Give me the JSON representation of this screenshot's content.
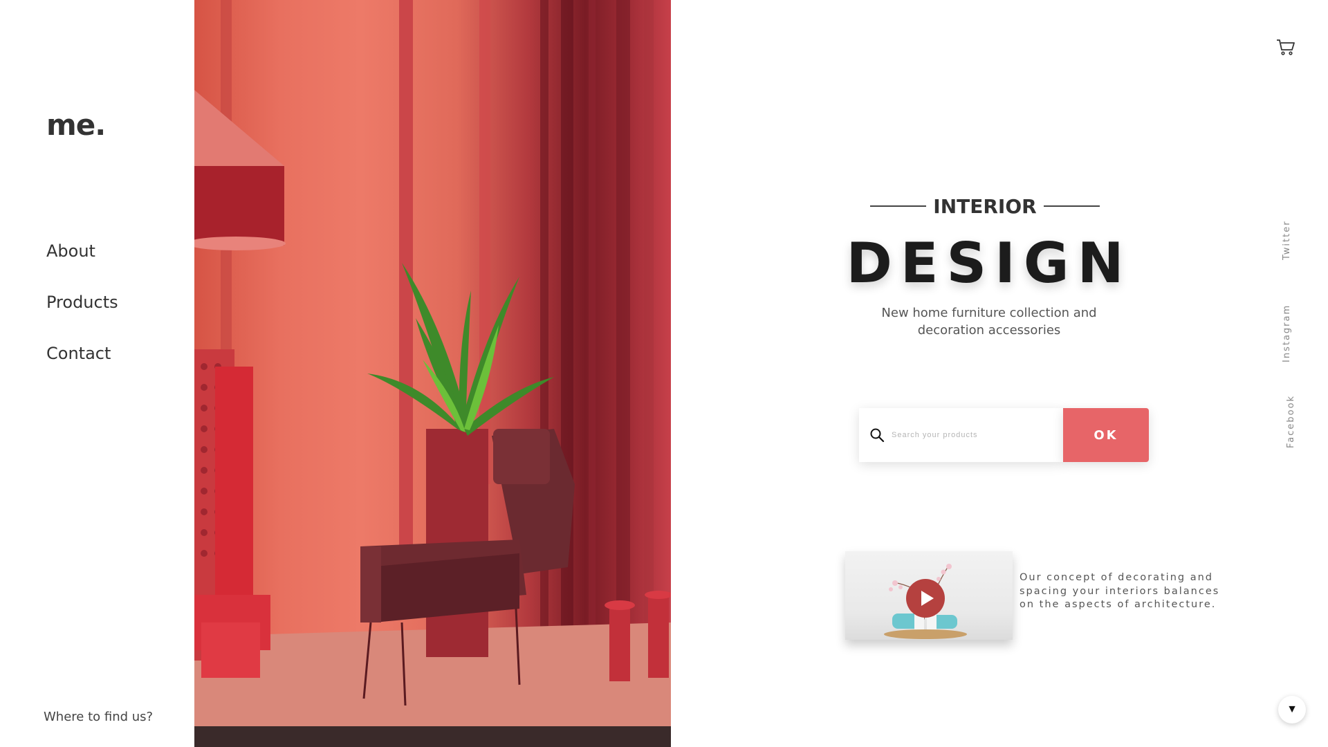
{
  "brand": {
    "logo": "me."
  },
  "nav": {
    "items": [
      {
        "label": "About"
      },
      {
        "label": "Products"
      },
      {
        "label": "Contact"
      }
    ]
  },
  "footer": {
    "find_us": "Where to find us?"
  },
  "hero": {
    "kicker": "INTERIOR",
    "title": "DESIGN",
    "subtitle": "New home furniture collection and decoration accessories"
  },
  "search": {
    "placeholder": "Search your products",
    "value": "",
    "button_label": "OK"
  },
  "video": {
    "description": "Our concept of decorating and spacing your interiors balances on the aspects of architecture."
  },
  "social": {
    "links": [
      {
        "label": "Twitter"
      },
      {
        "label": "Instagram"
      },
      {
        "label": "Facebook"
      }
    ]
  },
  "icons": {
    "cart": "shopping-cart-icon",
    "search": "search-icon",
    "play": "play-icon",
    "scroll": "chevron-down-icon"
  },
  "colors": {
    "accent": "#e76568",
    "play": "#b5413f",
    "text_dark": "#1c1c1c"
  },
  "scroll_glyph": "▼"
}
